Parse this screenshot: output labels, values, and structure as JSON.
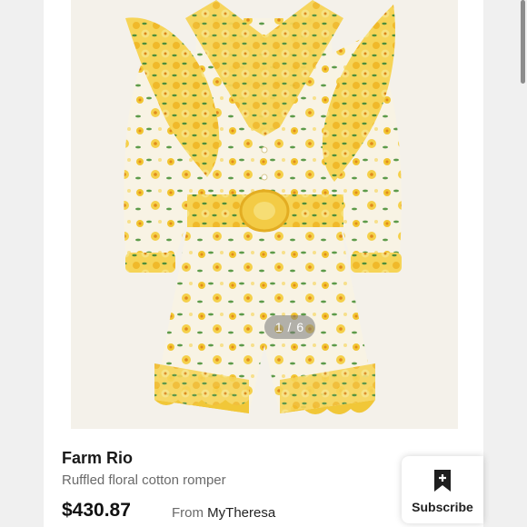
{
  "gallery": {
    "pager_text": "1 / 6",
    "current_image": 1,
    "total_images": 6
  },
  "product": {
    "brand": "Farm Rio",
    "name": "Ruffled floral cotton romper",
    "price": "$430.87",
    "from_label": "From",
    "retailer": "MyTheresa"
  },
  "subscribe": {
    "label": "Subscribe",
    "icon": "bookmark-plus-icon"
  },
  "colors": {
    "floral_yellow": "#f2c531",
    "fabric_cream": "#f8f3e4",
    "leaf_green": "#5d9b4a"
  }
}
